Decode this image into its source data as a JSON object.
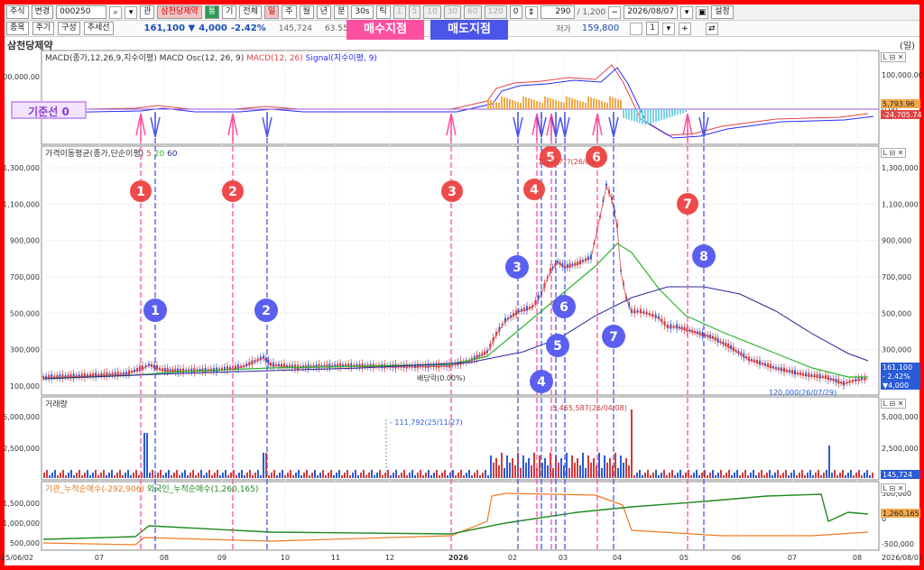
{
  "toolbar1": {
    "market_select": "주식",
    "change_select": "변경",
    "code_input": "000250",
    "search_icon": "search-icon",
    "rel_label": "관",
    "stock_name": "삼천당제약",
    "btn_tong": "통",
    "btn_gi": "기",
    "btn_all": "전체",
    "periods": [
      "일",
      "주",
      "월",
      "년",
      "분",
      "30s",
      "틱"
    ],
    "numbers": [
      "1",
      "5",
      "10",
      "30",
      "60",
      "120"
    ],
    "zero": "0",
    "count": "290",
    "slash_total": "/ 1,200",
    "date": "2026/08/07",
    "settings": "설정"
  },
  "toolbar2": {
    "btn_item": "종목",
    "btn_period": "주기",
    "btn_compose": "구성",
    "btn_trend": "추세선",
    "price": "161,100 ▼",
    "change": "4,000",
    "change_pct": "-2.42%",
    "volume": "145,724",
    "ratio": "63.55%",
    "low_label": "저가",
    "low_value": "159,800",
    "page": "1"
  },
  "tags": {
    "buy": "매수지점",
    "sell": "매도지점",
    "baseline": "기준선 0"
  },
  "chart_title": "삼천당제약",
  "chart_title_right": "(일)",
  "panels": {
    "macd_title": "MACD(종가,12,26,9,지수이평) MACD Osc(12, 26, 9)",
    "macd_series_red": "MACD(12, 26)",
    "macd_series_blue": "Signal(지수이평, 9)",
    "price_title": "가격이동평균(종가,단순이평)",
    "ma5": "5",
    "ma20": "20",
    "ma60": "60",
    "volume_title": "거래량",
    "flow_title_a": "기관_누적순매수(-292,906)",
    "flow_title_b": "외국인_누적순매수(1,260,165)"
  },
  "annotations": {
    "max_price_label": "1,3??,???(26/03/",
    "dividend_label": "배당락(0.00%)",
    "min_price_label": "120,000(26/07/29)",
    "vol_max_label": "5,465,587(26/04/08)",
    "vol_label_2": "111,792(25/11/27)"
  },
  "right_labels": {
    "macd_a": "5,793.96",
    "macd_b": "-24,705.74",
    "price_a": "161,100",
    "price_b": "- 2.42%",
    "price_c": "▼4,000",
    "volume": "145,724",
    "flow": "1,260,165"
  },
  "axes": {
    "macd_y": [
      "00,000.00",
      "0.00"
    ],
    "macd_y_right": [
      "100,000.00",
      "50,000.00",
      "0.00",
      "-50,000.00"
    ],
    "price_y": [
      "1,300,000",
      "1,100,000",
      "900,000",
      "700,000",
      "500,000",
      "300,000",
      "100,000"
    ],
    "volume_y": [
      "5,000,000",
      "2,500,000"
    ],
    "flow_y_left": [
      "1,500,000",
      "1,000,000",
      "500,000"
    ],
    "flow_y_right": [
      "500,000",
      "0",
      "-500,000"
    ],
    "x": [
      "2025/06/02",
      "07",
      "08",
      "09",
      "10",
      "11",
      "12",
      "2026",
      "02",
      "03",
      "04",
      "05",
      "06",
      "07",
      "08",
      "2026/08/07"
    ]
  },
  "buy_points": [
    "1",
    "2",
    "3",
    "4",
    "5",
    "6",
    "7"
  ],
  "sell_points": [
    "1",
    "2",
    "3",
    "4",
    "5",
    "6",
    "7",
    "8"
  ],
  "colors": {
    "buy": "#ff4fa0",
    "sell": "#4b55e8",
    "red_circle": "#ef4a4a",
    "ma5": "#e04545",
    "ma20": "#2db52d",
    "ma60": "#2a2a9a"
  }
}
